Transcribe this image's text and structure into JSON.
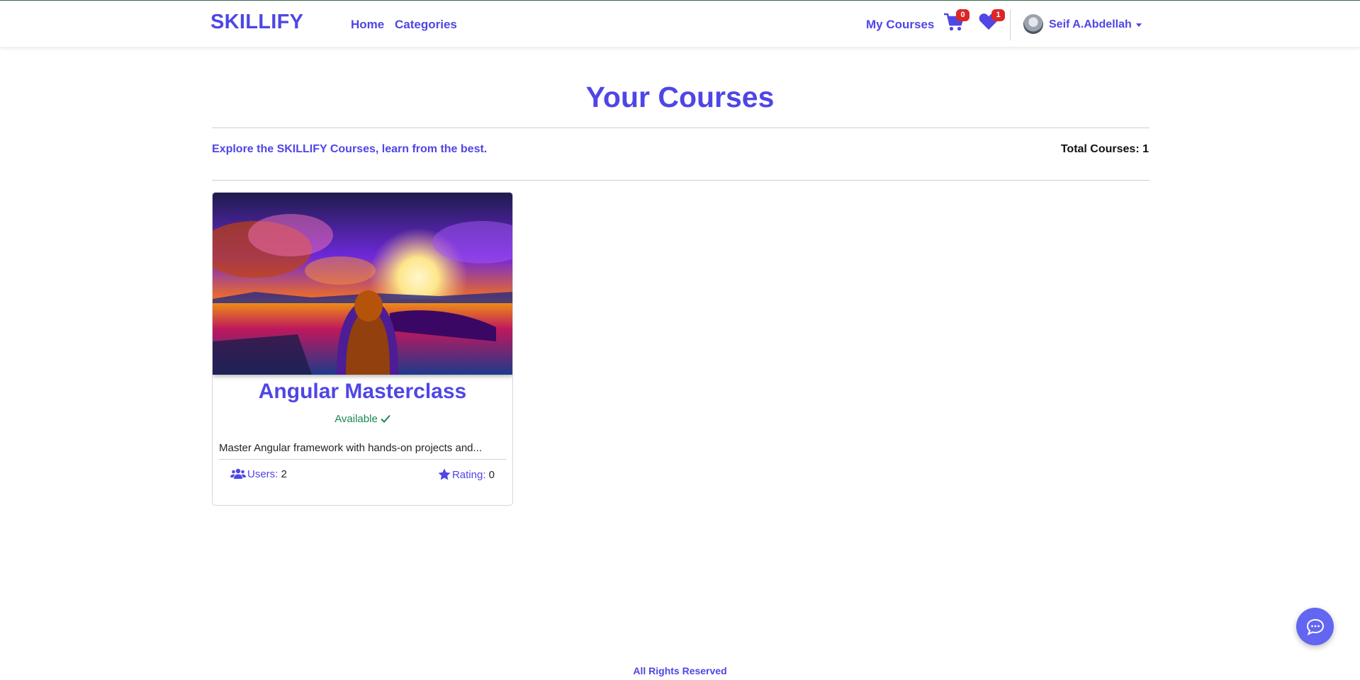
{
  "navbar": {
    "brand": "SKILLIFY",
    "links": {
      "home": "Home",
      "categories": "Categories",
      "my_courses": "My Courses"
    },
    "cart_count": "0",
    "wishlist_count": "1",
    "user_name": "Seif A.Abdellah"
  },
  "header": {
    "title": "Your Courses",
    "subtitle": "Explore the SKILLIFY Courses, learn from the best.",
    "total_label": "Total Courses: 1"
  },
  "courses": [
    {
      "title": "Angular Masterclass",
      "status": "Available",
      "description": "Master Angular framework with hands-on projects and...",
      "users_label": "Users:",
      "users_value": "2",
      "rating_label": "Rating:",
      "rating_value": "0"
    }
  ],
  "footer": {
    "text": "All Rights Reserved"
  },
  "icons": {
    "cart": "cart-icon",
    "heart": "heart-icon",
    "users": "users-icon",
    "star": "star-icon",
    "check": "check-icon",
    "chat": "chat-icon"
  },
  "colors": {
    "brand": "#4f46e5",
    "success": "#198754",
    "badge": "#dc2626",
    "chat": "#6366f1"
  }
}
